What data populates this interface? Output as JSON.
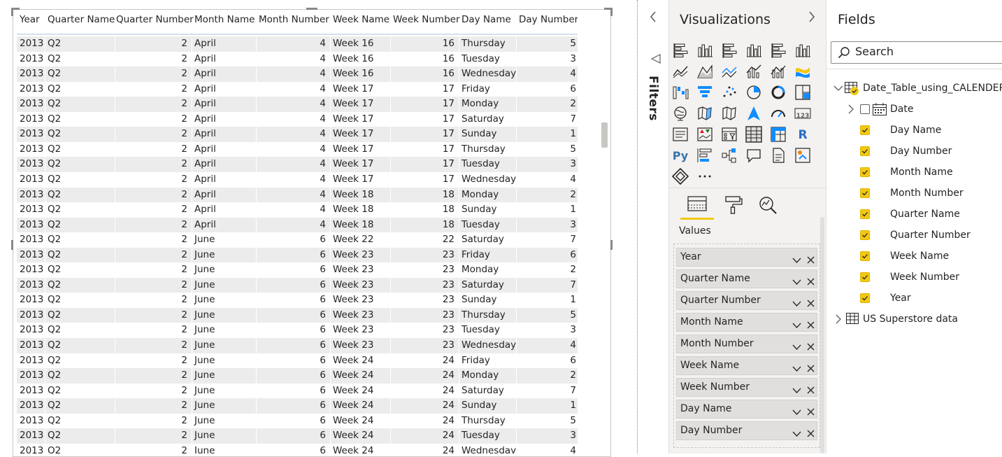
{
  "table": {
    "columns": [
      "Year",
      "Quarter Name",
      "Quarter Number",
      "Month Name",
      "Month Number",
      "Week Name",
      "Week Number",
      "Day Name",
      "Day Number"
    ],
    "rows": [
      [
        "2013",
        "Q2",
        "2",
        "April",
        "4",
        "Week 16",
        "16",
        "Thursday",
        "5"
      ],
      [
        "2013",
        "Q2",
        "2",
        "April",
        "4",
        "Week 16",
        "16",
        "Tuesday",
        "3"
      ],
      [
        "2013",
        "Q2",
        "2",
        "April",
        "4",
        "Week 16",
        "16",
        "Wednesday",
        "4"
      ],
      [
        "2013",
        "Q2",
        "2",
        "April",
        "4",
        "Week 17",
        "17",
        "Friday",
        "6"
      ],
      [
        "2013",
        "Q2",
        "2",
        "April",
        "4",
        "Week 17",
        "17",
        "Monday",
        "2"
      ],
      [
        "2013",
        "Q2",
        "2",
        "April",
        "4",
        "Week 17",
        "17",
        "Saturday",
        "7"
      ],
      [
        "2013",
        "Q2",
        "2",
        "April",
        "4",
        "Week 17",
        "17",
        "Sunday",
        "1"
      ],
      [
        "2013",
        "Q2",
        "2",
        "April",
        "4",
        "Week 17",
        "17",
        "Thursday",
        "5"
      ],
      [
        "2013",
        "Q2",
        "2",
        "April",
        "4",
        "Week 17",
        "17",
        "Tuesday",
        "3"
      ],
      [
        "2013",
        "Q2",
        "2",
        "April",
        "4",
        "Week 17",
        "17",
        "Wednesday",
        "4"
      ],
      [
        "2013",
        "Q2",
        "2",
        "April",
        "4",
        "Week 18",
        "18",
        "Monday",
        "2"
      ],
      [
        "2013",
        "Q2",
        "2",
        "April",
        "4",
        "Week 18",
        "18",
        "Sunday",
        "1"
      ],
      [
        "2013",
        "Q2",
        "2",
        "April",
        "4",
        "Week 18",
        "18",
        "Tuesday",
        "3"
      ],
      [
        "2013",
        "Q2",
        "2",
        "June",
        "6",
        "Week 22",
        "22",
        "Saturday",
        "7"
      ],
      [
        "2013",
        "Q2",
        "2",
        "June",
        "6",
        "Week 23",
        "23",
        "Friday",
        "6"
      ],
      [
        "2013",
        "Q2",
        "2",
        "June",
        "6",
        "Week 23",
        "23",
        "Monday",
        "2"
      ],
      [
        "2013",
        "Q2",
        "2",
        "June",
        "6",
        "Week 23",
        "23",
        "Saturday",
        "7"
      ],
      [
        "2013",
        "Q2",
        "2",
        "June",
        "6",
        "Week 23",
        "23",
        "Sunday",
        "1"
      ],
      [
        "2013",
        "Q2",
        "2",
        "June",
        "6",
        "Week 23",
        "23",
        "Thursday",
        "5"
      ],
      [
        "2013",
        "Q2",
        "2",
        "June",
        "6",
        "Week 23",
        "23",
        "Tuesday",
        "3"
      ],
      [
        "2013",
        "Q2",
        "2",
        "June",
        "6",
        "Week 23",
        "23",
        "Wednesday",
        "4"
      ],
      [
        "2013",
        "Q2",
        "2",
        "June",
        "6",
        "Week 24",
        "24",
        "Friday",
        "6"
      ],
      [
        "2013",
        "Q2",
        "2",
        "June",
        "6",
        "Week 24",
        "24",
        "Monday",
        "2"
      ],
      [
        "2013",
        "Q2",
        "2",
        "June",
        "6",
        "Week 24",
        "24",
        "Saturday",
        "7"
      ],
      [
        "2013",
        "Q2",
        "2",
        "June",
        "6",
        "Week 24",
        "24",
        "Sunday",
        "1"
      ],
      [
        "2013",
        "Q2",
        "2",
        "June",
        "6",
        "Week 24",
        "24",
        "Thursday",
        "5"
      ],
      [
        "2013",
        "Q2",
        "2",
        "June",
        "6",
        "Week 24",
        "24",
        "Tuesday",
        "3"
      ],
      [
        "2013",
        "Q2",
        "2",
        "June",
        "6",
        "Week 24",
        "24",
        "Wednesday",
        "4"
      ]
    ]
  },
  "filters": {
    "label": "Filters",
    "collapse_icon": "chevron-left-icon"
  },
  "visualizations": {
    "title": "Visualizations",
    "expand_icon": "chevron-right-icon",
    "icons": [
      "stacked-bar-chart",
      "stacked-column-chart",
      "clustered-bar-chart",
      "clustered-column-chart",
      "100-stacked-bar-chart",
      "100-stacked-column-chart",
      "line-chart",
      "area-chart",
      "stacked-area-chart",
      "line-and-stacked-column-chart",
      "line-and-clustered-column-chart",
      "ribbon-chart",
      "waterfall-chart",
      "funnel-chart",
      "scatter-chart",
      "pie-chart",
      "donut-chart",
      "treemap",
      "map",
      "filled-map",
      "shape-map",
      "azure-map",
      "gauge",
      "card",
      "multi-row-card",
      "kpi",
      "slicer",
      "table",
      "matrix",
      "r-script-visual",
      "python-visual",
      "key-influencers",
      "decomposition-tree",
      "qa-visual",
      "smart-narrative",
      "paginated-report",
      "power-apps",
      "more-visuals"
    ],
    "python_label": "Py",
    "r_label": "R",
    "card_label": "123",
    "more_label": "...",
    "tabs": [
      "fields-tab",
      "format-tab",
      "analytics-tab"
    ],
    "values_label": "Values",
    "wells": [
      "Year",
      "Quarter Name",
      "Quarter Number",
      "Month Name",
      "Month Number",
      "Week Name",
      "Week Number",
      "Day Name",
      "Day Number"
    ]
  },
  "fields": {
    "title": "Fields",
    "search_placeholder": "Search",
    "tables": [
      {
        "name": "Date_Table_using_CALENDER",
        "expanded": true,
        "items": [
          {
            "name": "Date",
            "type": "hierarchy",
            "checked": false
          },
          {
            "name": "Day Name",
            "checked": true
          },
          {
            "name": "Day Number",
            "checked": true
          },
          {
            "name": "Month Name",
            "checked": true
          },
          {
            "name": "Month Number",
            "checked": true
          },
          {
            "name": "Quarter Name",
            "checked": true
          },
          {
            "name": "Quarter Number",
            "checked": true
          },
          {
            "name": "Week Name",
            "checked": true
          },
          {
            "name": "Week Number",
            "checked": true
          },
          {
            "name": "Year",
            "checked": true
          }
        ]
      },
      {
        "name": "US Superstore data",
        "expanded": false
      }
    ]
  },
  "colors": {
    "accent": "#f2c811",
    "viz_blue": "#118dff",
    "row_shade": "#ececec",
    "pane_bg": "#f3f2f1"
  }
}
